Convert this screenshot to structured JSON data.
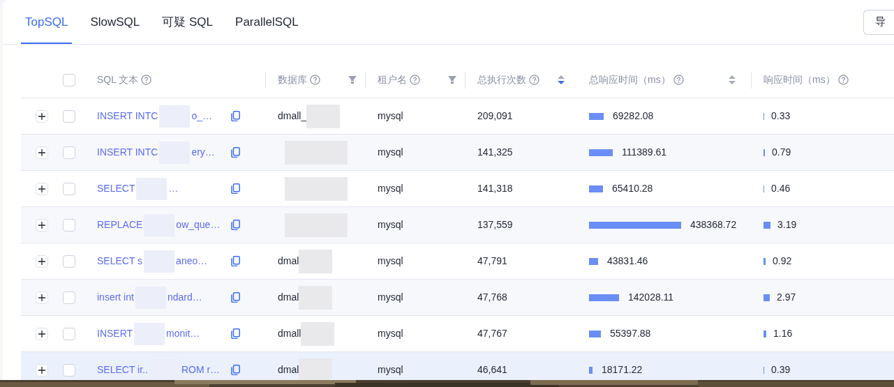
{
  "tabs": [
    {
      "label": "TopSQL",
      "selected": true
    },
    {
      "label": "SlowSQL",
      "selected": false
    },
    {
      "label": "可疑 SQL",
      "selected": false
    },
    {
      "label": "ParallelSQL",
      "selected": false
    }
  ],
  "export_button": "导",
  "table": {
    "all_checked": false,
    "columns": [
      {
        "label": "SQL 文本",
        "help": true,
        "filter": false,
        "sortable": false
      },
      {
        "label": "数据库",
        "help": true,
        "filter": true,
        "sortable": false
      },
      {
        "label": "租户名",
        "help": true,
        "filter": true,
        "sortable": false
      },
      {
        "label": "总执行次数",
        "help": true,
        "filter": false,
        "sortable": true,
        "sorted": true
      },
      {
        "label": "总响应时间（ms）",
        "help": true,
        "filter": false,
        "sortable": true,
        "sorted": false
      },
      {
        "label": "响应时间（ms）",
        "help": true,
        "filter": false,
        "sortable": false
      }
    ],
    "rows": [
      {
        "sql_start": "INSERT INTC",
        "sql_end": "o_…",
        "database": "dmall_",
        "tenant": "mysql",
        "executions": "209,091",
        "total_time": "69282.08",
        "response_time": "0.33",
        "checked": false,
        "highlighted": false
      },
      {
        "sql_start": "INSERT INTC",
        "sql_end": "ery…",
        "tenant": "mysql",
        "executions": "141,325",
        "total_time": "111389.61",
        "response_time": "0.79",
        "checked": false,
        "highlighted": false
      },
      {
        "sql_start": "SELECT",
        "sql_end": "…",
        "tenant": "mysql",
        "executions": "141,318",
        "total_time": "65410.28",
        "response_time": "0.46",
        "checked": false,
        "highlighted": false
      },
      {
        "sql_start": "REPLACE",
        "sql_end": "ow_que…",
        "tenant": "mysql",
        "executions": "137,559",
        "total_time": "438368.72",
        "response_time": "3.19",
        "checked": false,
        "highlighted": false
      },
      {
        "sql_start": "SELECT s",
        "sql_end": "aneo…",
        "database": "dmal",
        "tenant": "mysql",
        "executions": "47,791",
        "total_time": "43831.46",
        "response_time": "0.92",
        "checked": false,
        "highlighted": false
      },
      {
        "sql_start": "insert int",
        "sql_end": "ndard…",
        "database": "dmal",
        "tenant": "mysql",
        "executions": "47,768",
        "total_time": "142028.11",
        "response_time": "2.97",
        "checked": false,
        "highlighted": false
      },
      {
        "sql_start": "INSERT",
        "sql_end": "monit…",
        "database": "dmall",
        "tenant": "mysql",
        "executions": "47,767",
        "total_time": "55397.88",
        "response_time": "1.16",
        "checked": false,
        "highlighted": false
      },
      {
        "sql_start": "SELECT ir..",
        "sql_end": "ROM r…",
        "database": "dmal",
        "tenant": "mysql",
        "executions": "46,641",
        "total_time": "18171.22",
        "response_time": "0.39",
        "checked": false,
        "highlighted": true
      }
    ]
  }
}
